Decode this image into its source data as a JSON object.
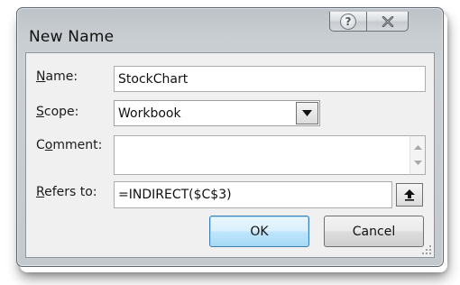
{
  "dialog": {
    "title": "New Name",
    "help_glyph": "?",
    "close_glyph": "X"
  },
  "fields": {
    "name": {
      "label_key": "N",
      "label_rest": "ame:",
      "value": "StockChart"
    },
    "scope": {
      "label_key": "S",
      "label_rest": "cope:",
      "value": "Workbook"
    },
    "comment": {
      "label_first": "C",
      "label_key": "o",
      "label_rest": "mment:",
      "value": ""
    },
    "refers_to": {
      "label_key": "R",
      "label_rest": "efers to:",
      "value": "=INDIRECT($C$3)"
    }
  },
  "buttons": {
    "ok": "OK",
    "cancel": "Cancel"
  },
  "icons": {
    "help": "help-icon",
    "close": "close-icon",
    "dropdown": "chevron-down-icon",
    "scroll_up": "scroll-up-icon",
    "scroll_down": "scroll-down-icon",
    "collapse": "collapse-dialog-icon",
    "grip": "resize-grip-icon"
  }
}
